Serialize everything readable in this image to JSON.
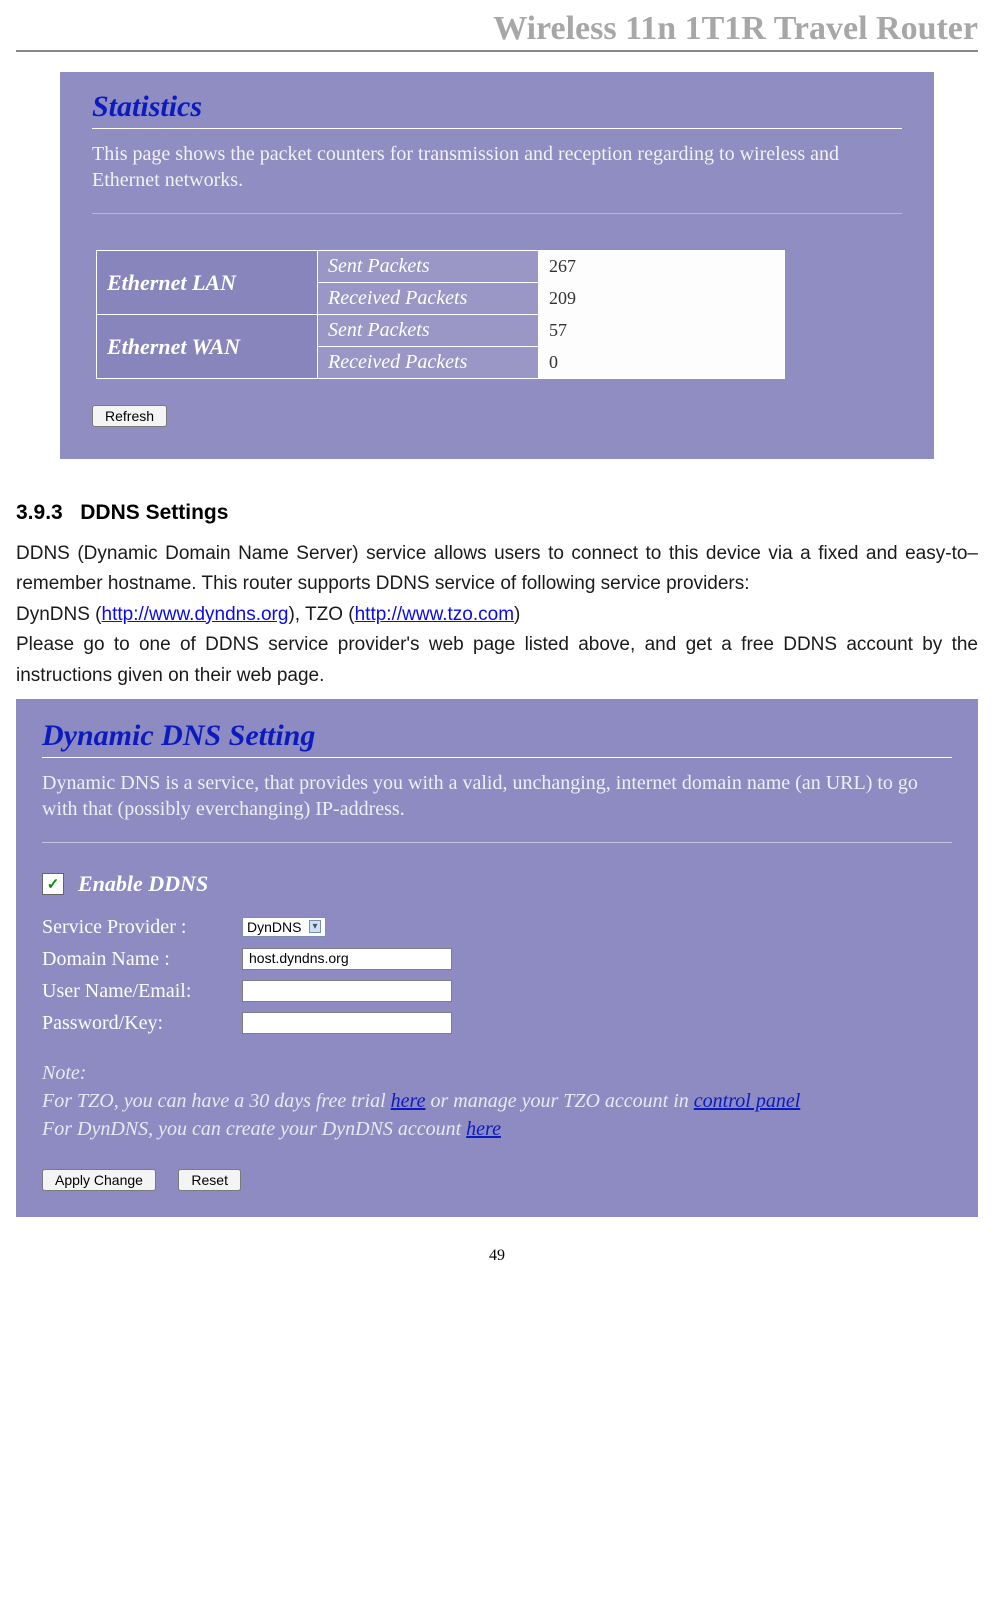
{
  "header": {
    "title": "Wireless 11n 1T1R Travel Router"
  },
  "stats_panel": {
    "title": "Statistics",
    "description": "This page shows the packet counters for transmission and reception regarding to wireless and Ethernet networks.",
    "rows": [
      {
        "iface": "Ethernet LAN",
        "metric": "Sent Packets",
        "value": "267"
      },
      {
        "iface": "",
        "metric": "Received Packets",
        "value": "209"
      },
      {
        "iface": "Ethernet WAN",
        "metric": "Sent Packets",
        "value": "57"
      },
      {
        "iface": "",
        "metric": "Received Packets",
        "value": "0"
      }
    ],
    "refresh_label": "Refresh"
  },
  "section": {
    "number": "3.9.3",
    "title": "DDNS Settings",
    "para1_a": "DDNS (Dynamic Domain Name Server) service allows users to connect to this device via a fixed and easy-to–remember hostname. This router supports DDNS service of following service providers:",
    "dyndns_label": "DynDNS (",
    "dyndns_url": "http://www.dyndns.org",
    "tzo_mid": "), TZO (",
    "tzo_url": "http://www.tzo.com",
    "tzo_close": ")",
    "para2": "Please go to one of DDNS service provider's web page listed above, and get a free DDNS account by the instructions given on their web page."
  },
  "ddns_panel": {
    "title": "Dynamic DNS  Setting",
    "description": "Dynamic DNS is a service, that provides you with a valid, unchanging, internet domain name (an URL) to go with that (possibly everchanging) IP-address.",
    "enable_label": "Enable DDNS",
    "enable_checked": true,
    "fields": {
      "service_provider_label": "Service Provider :",
      "service_provider_value": "DynDNS",
      "domain_label": "Domain Name :",
      "domain_value": "host.dyndns.org",
      "user_label": "User Name/Email:",
      "user_value": "",
      "password_label": "Password/Key:",
      "password_value": ""
    },
    "note_heading": "Note:",
    "note_tzo_a": "For TZO, you can have a 30 days free trial ",
    "note_here1": "here",
    "note_tzo_b": " or manage your TZO account in ",
    "note_control_panel": "control panel",
    "note_dyndns_a": "For DynDNS, you can create your DynDNS account ",
    "note_here2": "here",
    "apply_label": "Apply Change",
    "reset_label": "Reset"
  },
  "page_number": "49"
}
